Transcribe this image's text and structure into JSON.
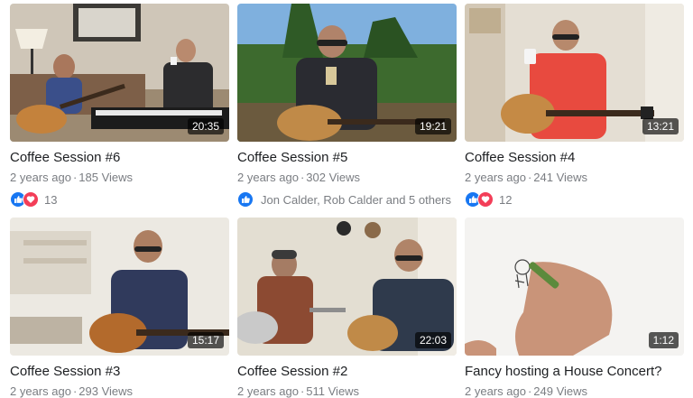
{
  "videos": [
    {
      "title": "Coffee Session #6",
      "age": "2 years ago",
      "views": "185 Views",
      "duration": "20:35",
      "reactions": {
        "count": "13",
        "names": ""
      }
    },
    {
      "title": "Coffee Session #5",
      "age": "2 years ago",
      "views": "302 Views",
      "duration": "19:21",
      "reactions": {
        "count": "",
        "names": "Jon Calder, Rob Calder and 5 others"
      }
    },
    {
      "title": "Coffee Session #4",
      "age": "2 years ago",
      "views": "241 Views",
      "duration": "13:21",
      "reactions": {
        "count": "12",
        "names": ""
      }
    },
    {
      "title": "Coffee Session #3",
      "age": "2 years ago",
      "views": "293 Views",
      "duration": "15:17"
    },
    {
      "title": "Coffee Session #2",
      "age": "2 years ago",
      "views": "511 Views",
      "duration": "22:03"
    },
    {
      "title": "Fancy hosting a House Concert?",
      "age": "2 years ago",
      "views": "249 Views",
      "duration": "1:12"
    }
  ],
  "meta_separator": "·",
  "icons": {
    "like": "like-thumbs-up-icon",
    "love": "love-heart-icon"
  },
  "colors": {
    "like": "#1877f2",
    "love": "#f33e58",
    "title": "#1c1e21",
    "meta": "#7a7d82"
  }
}
